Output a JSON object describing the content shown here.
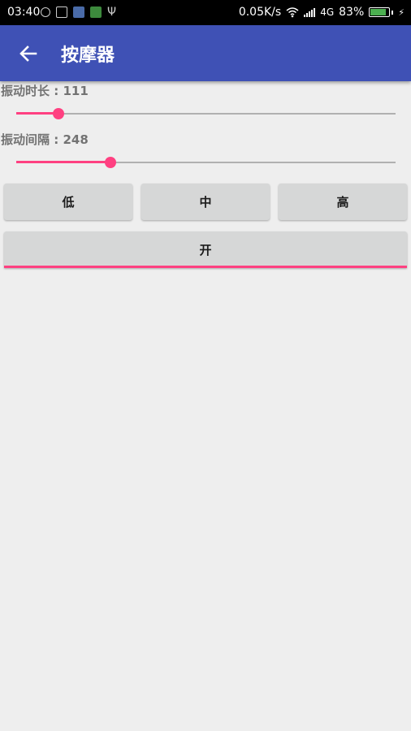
{
  "status_bar": {
    "time": "03:40",
    "network_speed": "0.05K/s",
    "network_type": "4G",
    "battery_percent_label": "83%",
    "battery_level": 0.83,
    "icons": [
      "notification-icon",
      "screenshot-icon",
      "app-icon",
      "app-icon",
      "usb-icon",
      "wifi-icon",
      "signal-icon",
      "battery-icon",
      "charging-icon"
    ]
  },
  "app_bar": {
    "title": "按摩器",
    "back_icon": "arrow-left-icon",
    "color": "#3f51b5"
  },
  "settings": {
    "duration": {
      "label": "振动时长 : 111",
      "value": 111,
      "max": 1000
    },
    "interval": {
      "label": "振动间隔 : 248",
      "value": 248,
      "max": 1000
    }
  },
  "level_buttons": {
    "low": "低",
    "medium": "中",
    "high": "高"
  },
  "toggle_button": {
    "label": "开"
  },
  "colors": {
    "accent": "#ff4081",
    "primary": "#3f51b5",
    "background": "#eeeeee",
    "button": "#d6d7d7"
  }
}
